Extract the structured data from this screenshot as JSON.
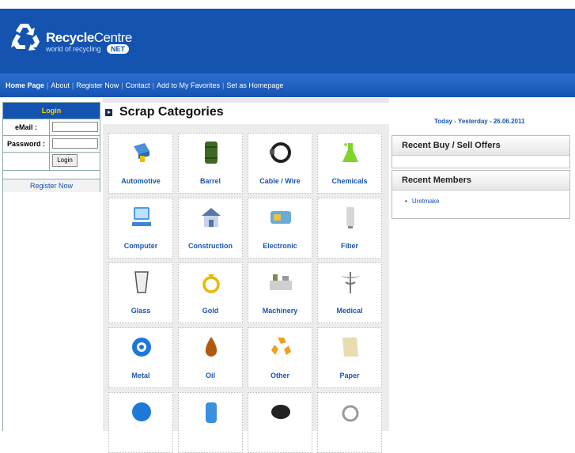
{
  "brand": {
    "name_bold": "Recycle",
    "name_light": "Centre",
    "tagline": "world of recycling",
    "badge": "NET"
  },
  "nav": {
    "items": [
      "Home Page",
      "About",
      "Register Now",
      "Contact",
      "Add to My Favorites",
      "Set as Homepage"
    ]
  },
  "login": {
    "title": "Login",
    "email_label": "eMail :",
    "password_label": "Password :",
    "button": "Login",
    "register": "Register Now"
  },
  "categories": {
    "title": "Scrap Categories",
    "items": [
      "Automotive",
      "Barrel",
      "Cable / Wire",
      "Chemicals",
      "Computer",
      "Construction",
      "Electronic",
      "Fiber",
      "Glass",
      "Gold",
      "Machinery",
      "Medical",
      "Metal",
      "Oil",
      "Other",
      "Paper",
      "",
      "",
      "",
      ""
    ]
  },
  "sidebar": {
    "date_line": "Today - Yesterday - 26.06.2011",
    "offers_title": "Recent Buy / Sell Offers",
    "members_title": "Recent Members",
    "members": [
      "Uretmake"
    ]
  },
  "colors": {
    "brand_blue": "#1553b0",
    "login_title": "#ffd400",
    "link_blue": "#1a55b0"
  },
  "icons": [
    "recycle-icon",
    "automotive-icon",
    "barrel-icon",
    "cable-icon",
    "chemicals-icon",
    "computer-icon",
    "construction-icon",
    "electronic-icon",
    "fiber-icon",
    "glass-icon",
    "gold-icon",
    "machinery-icon",
    "medical-icon",
    "metal-icon",
    "oil-icon",
    "other-icon",
    "paper-icon"
  ]
}
